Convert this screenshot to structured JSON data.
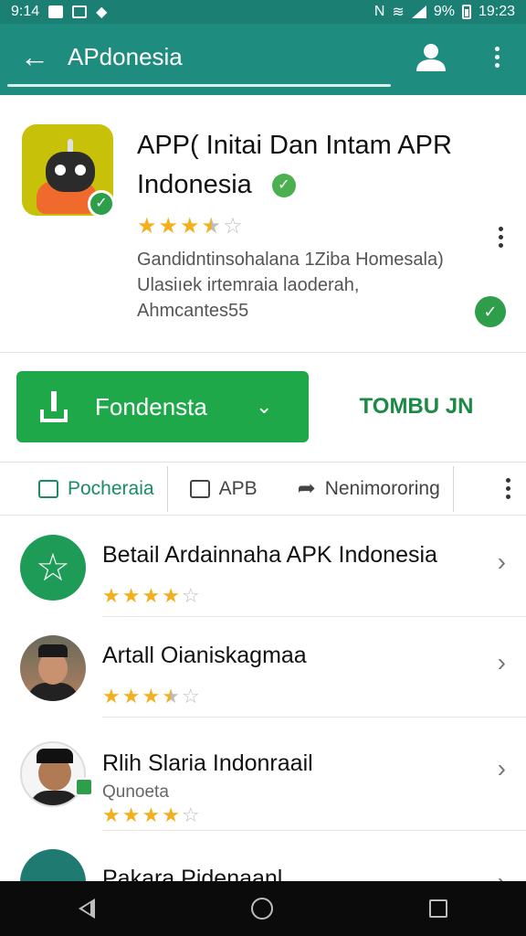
{
  "status_bar": {
    "time_left": "9:14",
    "battery": "9%",
    "time_right": "19:23"
  },
  "app_bar": {
    "title": "APdonesia"
  },
  "app": {
    "title_line1": "APP( Initai Dan Intam APR",
    "title_line2": "Indonesia",
    "rating": 3.5,
    "description": [
      "Gandidntinsohalana 1Ziba Homesala)",
      "Ulasiıek irtemraia laoderah,",
      "Ahmcantes55"
    ]
  },
  "actions": {
    "install_label": "Fondensta",
    "secondary_label": "TOMBU JN"
  },
  "tabs": [
    {
      "label": "Pocheraia",
      "active": true
    },
    {
      "label": "APB",
      "active": false
    },
    {
      "label": "Nenimororing",
      "active": false
    }
  ],
  "list": [
    {
      "title": "Betail Ardainnaha APK Indonesia",
      "subtitle": "",
      "rating": 4
    },
    {
      "title": "Artall Oianiskagmaa",
      "subtitle": "",
      "rating": 3.5
    },
    {
      "title": "Rlih Slaria Indonraail",
      "subtitle": "Qunoeta",
      "rating": 4
    },
    {
      "title": "Pakara Pidenaanl",
      "subtitle": "",
      "rating": 0
    }
  ],
  "colors": {
    "status_bar": "#1b7f74",
    "app_bar": "#1e8d80",
    "install_button": "#1fa84a",
    "accent_text": "#1b8a44",
    "star": "#f2b01e"
  },
  "icons": {
    "back": "arrow-left-icon",
    "profile": "person-icon",
    "more": "more-vert-icon",
    "verified": "check-circle-icon",
    "share": "share-icon",
    "download": "download-icon",
    "chevron": "chevron-right-icon"
  }
}
